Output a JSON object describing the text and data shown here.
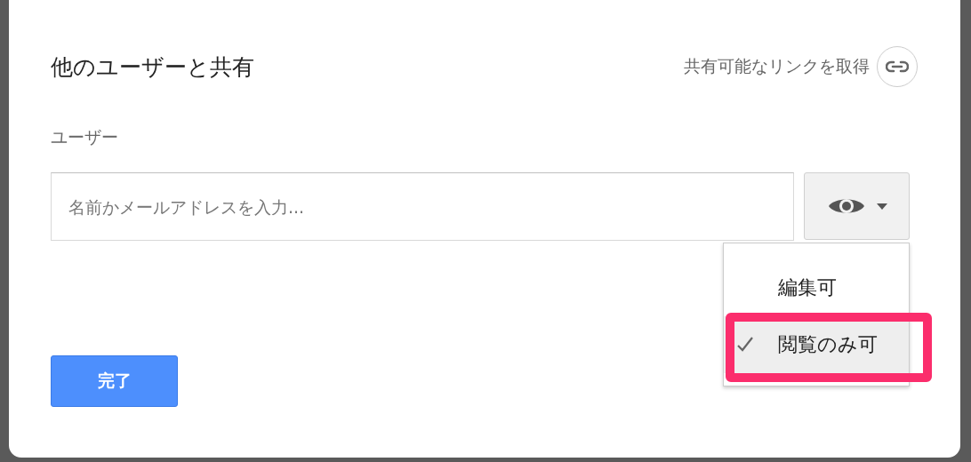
{
  "dialog": {
    "title": "他のユーザーと共有",
    "link_action": "共有可能なリンクを取得",
    "section_label": "ユーザー",
    "input": {
      "placeholder": "名前かメールアドレスを入力..."
    },
    "permission_menu": {
      "items": [
        {
          "label": "編集可",
          "selected": false
        },
        {
          "label": "閲覧のみ可",
          "selected": true
        }
      ]
    },
    "done_button": "完了"
  }
}
